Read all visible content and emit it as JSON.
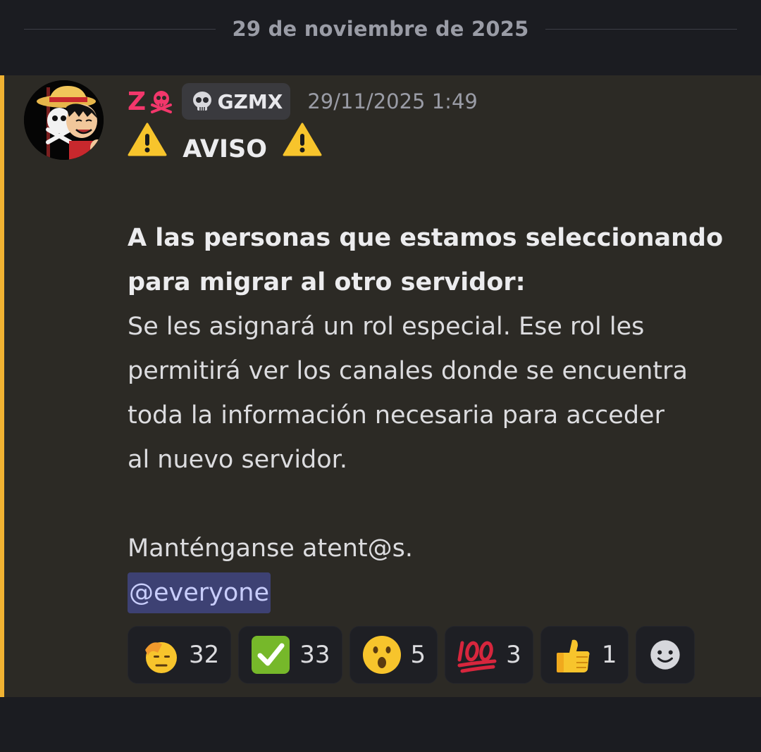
{
  "date_divider": {
    "text": "29 de noviembre de 2025"
  },
  "message": {
    "author": {
      "name": "Z",
      "name_emoji": "skull-crossbones",
      "color": "#f2376b"
    },
    "guild_tag": {
      "icon": "skull",
      "text": "GZMX"
    },
    "timestamp": "29/11/2025 1:49",
    "highlight_color": "#f0b232",
    "content": {
      "title": "AVISO",
      "bold_line_1": "A las personas que estamos seleccionando",
      "bold_line_2": "para migrar al otro servidor:",
      "body_line_1": "Se les asignará un rol especial. Ese rol les",
      "body_line_2": "permitirá ver los canales donde se encuentra",
      "body_line_3": "toda la información necesaria para acceder",
      "body_line_4": "al nuevo servidor.",
      "closing": "Manténganse atent@s.",
      "mention": "@everyone"
    },
    "reactions": [
      {
        "emoji": "saluting-face",
        "count": "32"
      },
      {
        "emoji": "check-mark-button",
        "count": "33"
      },
      {
        "emoji": "face-with-open-mouth",
        "count": "5"
      },
      {
        "emoji": "hundred-points",
        "count": "3"
      },
      {
        "emoji": "thumbs-up",
        "count": "1"
      }
    ],
    "add_reaction_icon": "add-reaction-smiley"
  }
}
